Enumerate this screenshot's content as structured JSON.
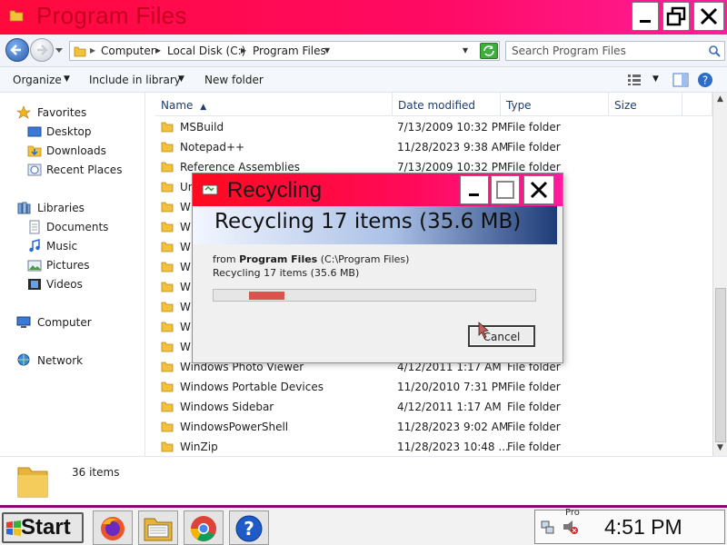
{
  "window": {
    "title": "Program Files",
    "controls": [
      "minimize",
      "restore",
      "close"
    ]
  },
  "address": {
    "crumbs": [
      "Computer",
      "Local Disk (C:)",
      "Program Files"
    ],
    "search_placeholder": "Search Program Files"
  },
  "toolbar": {
    "organize": "Organize",
    "include": "Include in library",
    "new_folder": "New folder"
  },
  "nav": {
    "favorites": "Favorites",
    "desktop": "Desktop",
    "downloads": "Downloads",
    "recent": "Recent Places",
    "libraries": "Libraries",
    "documents": "Documents",
    "music": "Music",
    "pictures": "Pictures",
    "videos": "Videos",
    "computer": "Computer",
    "network": "Network"
  },
  "columns": {
    "name": "Name",
    "date": "Date modified",
    "type": "Type",
    "size": "Size"
  },
  "rows": [
    {
      "name": "MSBuild",
      "date": "7/13/2009 10:32 PM",
      "type": "File folder"
    },
    {
      "name": "Notepad++",
      "date": "11/28/2023 9:38 AM",
      "type": "File folder"
    },
    {
      "name": "Reference Assemblies",
      "date": "7/13/2009 10:32 PM",
      "type": "File folder"
    },
    {
      "name": "Uninstall Information",
      "date": "",
      "type": ""
    },
    {
      "name": "W",
      "date": "",
      "type": ""
    },
    {
      "name": "W",
      "date": "",
      "type": ""
    },
    {
      "name": "W",
      "date": "",
      "type": ""
    },
    {
      "name": "W",
      "date": "",
      "type": ""
    },
    {
      "name": "W",
      "date": "",
      "type": ""
    },
    {
      "name": "W",
      "date": "",
      "type": ""
    },
    {
      "name": "W",
      "date": "",
      "type": ""
    },
    {
      "name": "W",
      "date": "",
      "type": ""
    },
    {
      "name": "Windows Photo Viewer",
      "date": "4/12/2011 1:17 AM",
      "type": "File folder"
    },
    {
      "name": "Windows Portable Devices",
      "date": "11/20/2010 7:31 PM",
      "type": "File folder"
    },
    {
      "name": "Windows Sidebar",
      "date": "4/12/2011 1:17 AM",
      "type": "File folder"
    },
    {
      "name": "WindowsPowerShell",
      "date": "11/28/2023 9:02 AM",
      "type": "File folder"
    },
    {
      "name": "WinZip",
      "date": "11/28/2023 10:48 ...",
      "type": "File folder"
    }
  ],
  "details": {
    "count": "36 items"
  },
  "dialog": {
    "title": "Recycling",
    "banner": "Recycling 17 items (35.6 MB)",
    "from_prefix": "from ",
    "from_bold": "Program Files",
    "from_path": " (C:\\Program Files)",
    "status": "Recycling 17 items (35.6 MB)",
    "progress": 0.22,
    "cancel": "Cancel"
  },
  "taskbar": {
    "start": "Start",
    "clock": "4:51 PM",
    "tray_text": "Pro"
  },
  "colors": {
    "title_red": "#ff0a3c",
    "accent_purple": "#8a0a6e",
    "progress_red": "#d9534f"
  }
}
